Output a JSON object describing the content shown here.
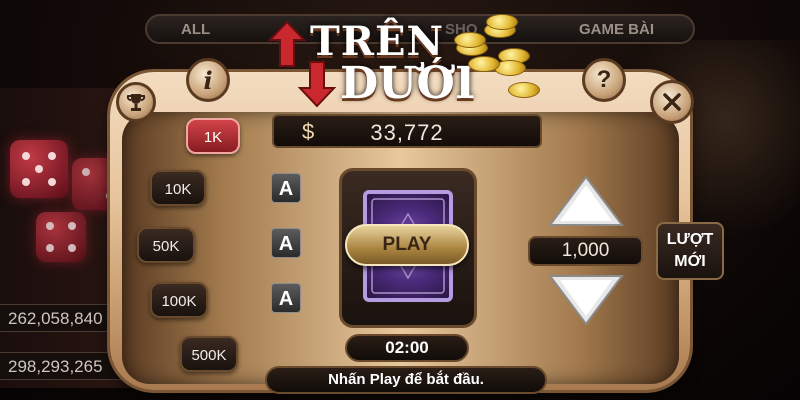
{
  "tabs": [
    "ALL",
    "SHO",
    "GAME BÀI"
  ],
  "logo": {
    "line1": "TRÊN",
    "line2": "DƯỚI"
  },
  "balance": {
    "symbol": "$",
    "amount": "33,772"
  },
  "chips": [
    {
      "label": "1K",
      "active": true
    },
    {
      "label": "10K",
      "active": false
    },
    {
      "label": "50K",
      "active": false
    },
    {
      "label": "100K",
      "active": false
    },
    {
      "label": "500K",
      "active": false
    }
  ],
  "cards": [
    "A",
    "A",
    "A"
  ],
  "play_label": "PLAY",
  "timer": "02:00",
  "bet_amount": "1,000",
  "new_round_label": [
    "LƯỢT",
    "MỚI"
  ],
  "status_text": "Nhấn Play để bắt đầu.",
  "side_balances": [
    "262,058,840",
    "298,293,265"
  ],
  "icons": {
    "info": "info-icon",
    "help": "question-icon",
    "close": "close-icon",
    "trophy": "trophy-icon"
  },
  "colors": {
    "active_chip": "#d2444a",
    "accent_gold": "#e2b630"
  }
}
